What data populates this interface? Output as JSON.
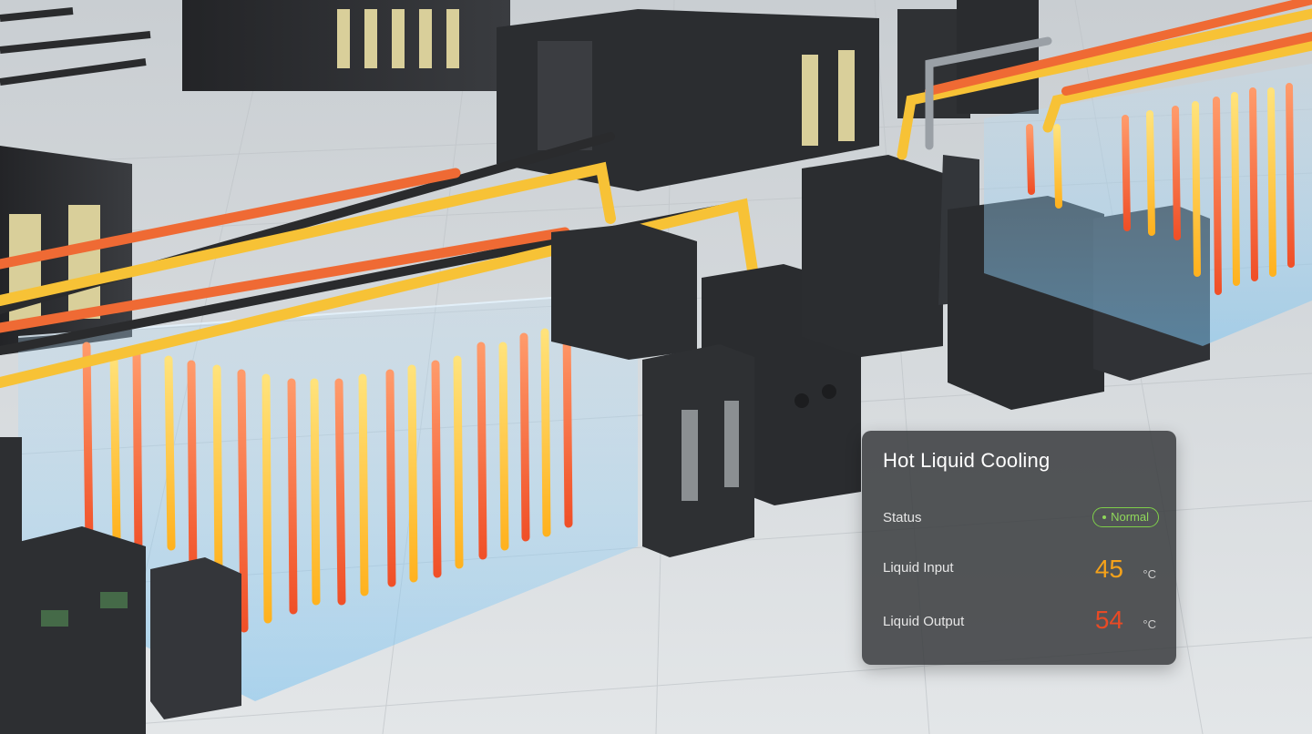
{
  "panel": {
    "title": "Hot Liquid Cooling",
    "status_label": "Status",
    "status_value": "Normal",
    "status_color": "#8fd75a",
    "input_label": "Liquid Input",
    "input_value": "45",
    "input_unit": "°C",
    "input_color": "#f5a21a",
    "output_label": "Liquid Output",
    "output_value": "54",
    "output_unit": "°C",
    "output_color": "#e84a25"
  },
  "colors": {
    "hot_pipe": "#ef6a34",
    "warm_pipe": "#f7c236",
    "chilled_column": "#9ed0f2",
    "rack": "#2d2f32",
    "floor": "#d9dde0"
  }
}
